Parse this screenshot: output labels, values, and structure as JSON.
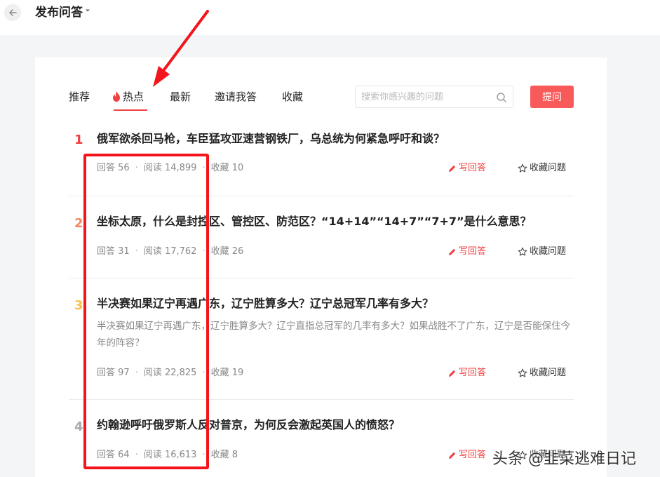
{
  "header": {
    "title": "发布问答"
  },
  "tabs": [
    {
      "label": "推荐"
    },
    {
      "label": "热点"
    },
    {
      "label": "最新"
    },
    {
      "label": "邀请我答"
    },
    {
      "label": "收藏"
    }
  ],
  "search": {
    "placeholder": "搜索你感兴趣的问题",
    "value": ""
  },
  "ask_button": "提问",
  "questions": [
    {
      "rank": "1",
      "rank_color": "#f04142",
      "title": "俄军欲杀回马枪，车臣猛攻亚速营钢铁厂，乌总统为何紧急呼吁和谈？",
      "desc": "",
      "answers": "回答 56",
      "reads": "阅读 14,899",
      "favorites": "收藏 10",
      "write": "写回答",
      "favorite_action": "收藏问题"
    },
    {
      "rank": "2",
      "rank_color": "#f7865a",
      "title": "坐标太原，什么是封控区、管控区、防范区？“14+14”“14+7”“7+7”是什么意思？",
      "desc": "",
      "answers": "回答 31",
      "reads": "阅读 17,762",
      "favorites": "收藏 26",
      "write": "写回答",
      "favorite_action": "收藏问题"
    },
    {
      "rank": "3",
      "rank_color": "#f9c14a",
      "title": "半决赛如果辽宁再遇广东，辽宁胜算多大？辽宁总冠军几率有多大？",
      "desc": "半决赛如果辽宁再遇广东，辽宁胜算多大？辽宁直指总冠军的几率有多大？如果战胜不了广东，辽宁是否能保住今年的阵容？",
      "answers": "回答 97",
      "reads": "阅读 22,825",
      "favorites": "收藏 19",
      "write": "写回答",
      "favorite_action": "收藏问题"
    },
    {
      "rank": "4",
      "rank_color": "#aaaaaa",
      "title": "约翰逊呼吁俄罗斯人反对普京，为何反会激起英国人的愤怒？",
      "desc": "",
      "answers": "回答 64",
      "reads": "阅读 16,613",
      "favorites": "收藏 8",
      "write": "写回答",
      "favorite_action": "收藏问题"
    }
  ],
  "watermark": "头条 @韭菜逃难日记",
  "colors": {
    "accent": "#f04142",
    "ask_button": "#f85959",
    "annotation": "#f4151c"
  }
}
